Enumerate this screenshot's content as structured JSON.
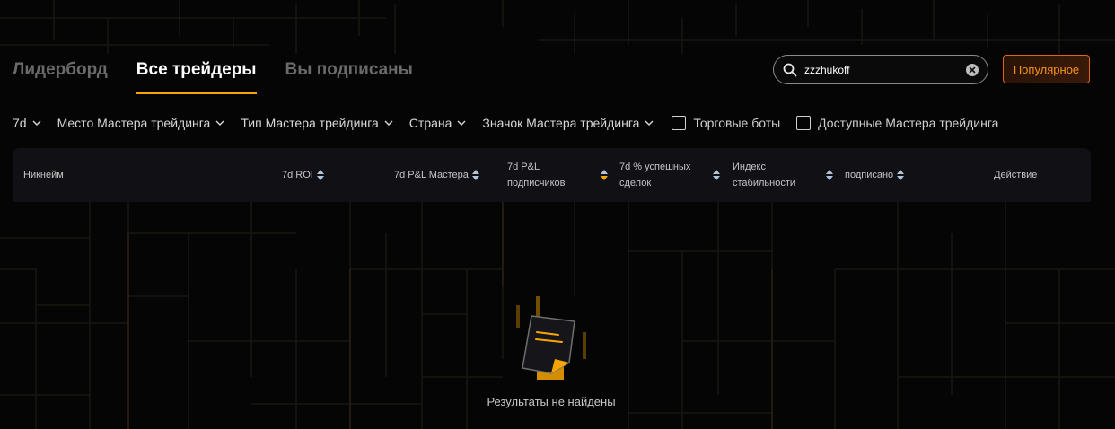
{
  "tabs": [
    {
      "label": "Лидерборд",
      "active": false
    },
    {
      "label": "Все трейдеры",
      "active": true
    },
    {
      "label": "Вы подписаны",
      "active": false
    }
  ],
  "search": {
    "value": "zzzhukoff",
    "icon": "search-icon",
    "clear_icon": "clear-circle-icon"
  },
  "popular_label": "Популярное",
  "filters": {
    "period": "7d",
    "place": "Место Мастера трейдинга",
    "type": "Тип Мастера трейдинга",
    "country": "Страна",
    "badge": "Значок Мастера трейдинга",
    "bots": "Торговые боты",
    "available": "Доступные Мастера трейдинга"
  },
  "columns": {
    "nickname": "Никнейм",
    "roi": "7d ROI",
    "pnl_master": "7d P&L Мастера",
    "pnl_subs_1": "7d P&L",
    "pnl_subs_2": "подписчиков",
    "winrate_1": "7d % успешных",
    "winrate_2": "сделок",
    "stability_1": "Индекс",
    "stability_2": "стабильности",
    "subscribed": "подписано",
    "action": "Действие"
  },
  "empty_text": "Результаты не найдены",
  "colors": {
    "accent": "#f7a600",
    "popular": "#f6941c",
    "sort_active": "#f7a600",
    "sort_inactive": "#b0c4de"
  }
}
